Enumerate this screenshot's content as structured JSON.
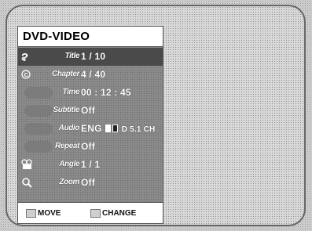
{
  "header": {
    "title": "DVD-VIDEO"
  },
  "rows": [
    {
      "label": "Title",
      "value": "1 / 10",
      "icon": "disc-title-icon"
    },
    {
      "label": "Chapter",
      "value": "4 / 40",
      "icon": "chapter-icon"
    },
    {
      "label": "Time",
      "value": "00 : 12 : 45",
      "icon": "clock-icon"
    },
    {
      "label": "Subtitle",
      "value": "Off",
      "icon": "subtitle-icon"
    },
    {
      "label": "Audio",
      "value_pre": "ENG",
      "value_post": "D 5.1 CH",
      "icon": "audio-icon"
    },
    {
      "label": "Repeat",
      "value": "Off",
      "icon": "repeat-icon"
    },
    {
      "label": "Angle",
      "value": "1 / 1",
      "icon": "camera-angle-icon"
    },
    {
      "label": "Zoom",
      "value": "Off",
      "icon": "zoom-icon"
    }
  ],
  "footer": {
    "move_label": "MOVE",
    "change_label": "CHANGE"
  },
  "colors": {
    "selected_row": "#4a4a4a",
    "panel": "#8a8a8a",
    "header_bg": "#ffffff"
  }
}
